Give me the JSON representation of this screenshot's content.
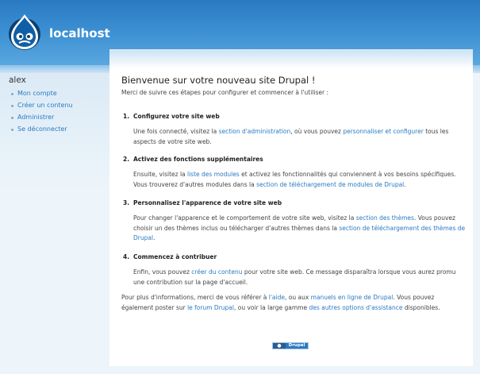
{
  "header": {
    "site_name": "localhost"
  },
  "sidebar": {
    "user": "alex",
    "items": [
      {
        "label": "Mon compte"
      },
      {
        "label": "Créer un contenu"
      },
      {
        "label": "Administrer"
      },
      {
        "label": "Se déconnecter"
      }
    ]
  },
  "main": {
    "title": "Bienvenue sur votre nouveau site Drupal !",
    "intro": "Merci de suivre ces étapes pour configurer et commencer à l'utiliser :",
    "steps": [
      {
        "num": "1.",
        "heading": "Configurez votre site web",
        "parts": [
          {
            "t": "Une fois connecté, visitez la "
          },
          {
            "t": "section d'administration",
            "link": true
          },
          {
            "t": ", où vous pouvez "
          },
          {
            "t": "personnaliser et configurer",
            "link": true
          },
          {
            "t": " tous les aspects de votre site web."
          }
        ]
      },
      {
        "num": "2.",
        "heading": "Activez des fonctions supplémentaires",
        "parts": [
          {
            "t": "Ensuite, visitez la "
          },
          {
            "t": "liste des modules",
            "link": true
          },
          {
            "t": " et activez les fonctionnalités qui conviennent à vos besoins spécifiques. Vous trouverez d'autres modules dans la "
          },
          {
            "t": "section de téléchargement de modules de Drupal",
            "link": true
          },
          {
            "t": "."
          }
        ]
      },
      {
        "num": "3.",
        "heading": "Personnalisez l'apparence de votre site web",
        "parts": [
          {
            "t": "Pour changer l'apparence et le comportement de votre site web, visitez la "
          },
          {
            "t": "section des thèmes",
            "link": true
          },
          {
            "t": ". Vous pouvez choisir un des thèmes inclus ou télécharger d'autres thèmes dans la "
          },
          {
            "t": "section de téléchargement des thèmes de Drupal",
            "link": true
          },
          {
            "t": "."
          }
        ]
      },
      {
        "num": "4.",
        "heading": "Commencez à contribuer",
        "parts": [
          {
            "t": "Enfin, vous pouvez "
          },
          {
            "t": "créer du contenu",
            "link": true
          },
          {
            "t": " pour votre site web. Ce message disparaîtra lorsque vous aurez promu une contribution sur la page d'accueil."
          }
        ]
      }
    ],
    "more": [
      {
        "t": "Pour plus d'informations, merci de vous référer à "
      },
      {
        "t": "l'aide",
        "link": true
      },
      {
        "t": ", ou aux "
      },
      {
        "t": "manuels en ligne de Drupal",
        "link": true
      },
      {
        "t": ". Vous pouvez également poster sur "
      },
      {
        "t": "le forum Drupal",
        "link": true
      },
      {
        "t": ", ou voir la large gamme "
      },
      {
        "t": "des autres options d'assistance",
        "link": true
      },
      {
        "t": " disponibles."
      }
    ],
    "powered_by": "Drupal"
  },
  "colors": {
    "link": "#2a7ac2",
    "header": "#2a7ac2"
  },
  "icons": {
    "logo": "drupal-drop-icon"
  }
}
